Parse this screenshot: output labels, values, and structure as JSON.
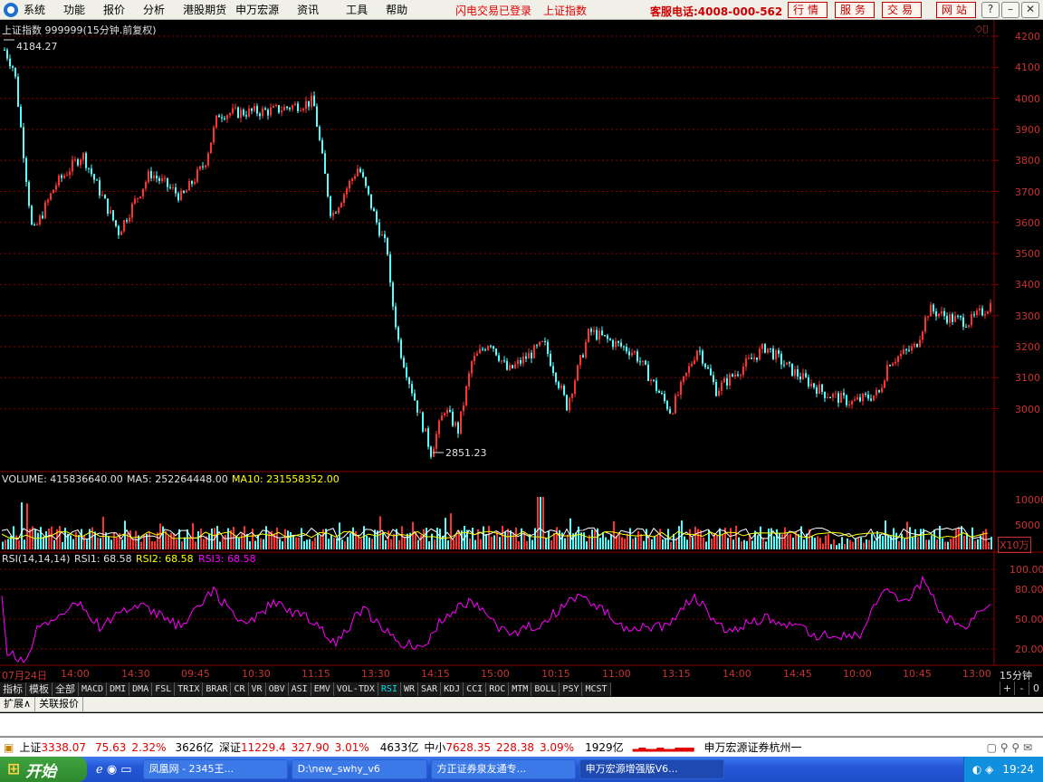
{
  "menubar": {
    "items": [
      "系统",
      "功能",
      "报价",
      "分析",
      "港股期货",
      "申万宏源",
      "资讯",
      "工具",
      "帮助"
    ],
    "status_login": "闪电交易已登录",
    "status_index": "上证指数",
    "hotline": "客服电话:4008-000-562",
    "toolbar_buttons": [
      "行情",
      "服务",
      "交易",
      "网站"
    ]
  },
  "main_chart": {
    "title": "上证指数 999999(15分钟.前复权)",
    "high_marker": "4184.27",
    "low_marker": "2851.23",
    "y_ticks": [
      "4200",
      "4100",
      "4000",
      "3900",
      "3800",
      "3700",
      "3600",
      "3500",
      "3400",
      "3300",
      "3200",
      "3100",
      "3000"
    ]
  },
  "volume_panel": {
    "label": "VOLUME: 415836640.00",
    "ma5": "MA5: 252264448.00",
    "ma10": "MA10: 231558352.00",
    "y_ticks": [
      "10000",
      "5000"
    ],
    "unit": "X10万"
  },
  "rsi_panel": {
    "label": "RSI(14,14,14)",
    "rsi1": "RSI1: 68.58",
    "rsi2": "RSI2: 68.58",
    "rsi3": "RSI3: 68.58",
    "y_ticks": [
      "100.00",
      "80.00",
      "50.00",
      "20.00"
    ]
  },
  "time_axis": {
    "labels": [
      "07月24日",
      "14:00",
      "14:30",
      "09:45",
      "10:30",
      "11:15",
      "13:30",
      "14:15",
      "15:00",
      "10:15",
      "11:00",
      "13:15",
      "14:00",
      "14:45",
      "10:00",
      "10:45",
      "13:00"
    ],
    "period": "15分钟"
  },
  "indicator_tabs": [
    "指标",
    "模板",
    "全部",
    "MACD",
    "DMI",
    "DMA",
    "FSL",
    "TRIX",
    "BRAR",
    "CR",
    "VR",
    "OBV",
    "ASI",
    "EMV",
    "VOL-TDX",
    "RSI",
    "WR",
    "SAR",
    "KDJ",
    "CCI",
    "ROC",
    "MTM",
    "BOLL",
    "PSY",
    "MCST"
  ],
  "zoom_controls": [
    "+",
    "-",
    "0"
  ],
  "lower_tabs": [
    "扩展∧",
    "关联报价"
  ],
  "ticker": {
    "sh_name": "上证",
    "sh_price": "3338.07",
    "sh_change": "75.63",
    "sh_pct": "2.32%",
    "sh_amount": "3626亿",
    "sz_name": "深证",
    "sz_price": "11229.4",
    "sz_change": "327.90",
    "sz_pct": "3.01%",
    "sz_amount": "4633亿",
    "zx_name": "中小",
    "zx_price": "7628.35",
    "zx_change": "228.38",
    "zx_pct": "3.09%",
    "zx_amount": "1929亿",
    "broker": "申万宏源证券杭州一"
  },
  "taskbar": {
    "start": "开始",
    "items": [
      "凤凰网 - 2345王...",
      "D:\\new_swhy_v6",
      "方正证券泉友通专...",
      "申万宏源增强版V6..."
    ],
    "clock": "19:24"
  },
  "colors": {
    "up": "#ff3232",
    "down": "#54ffff",
    "ma5": "#ffffff",
    "ma10": "#ffff00",
    "rsi": "#ff00ff",
    "grid": "#8b0000",
    "axis_text": "#c83232"
  }
}
